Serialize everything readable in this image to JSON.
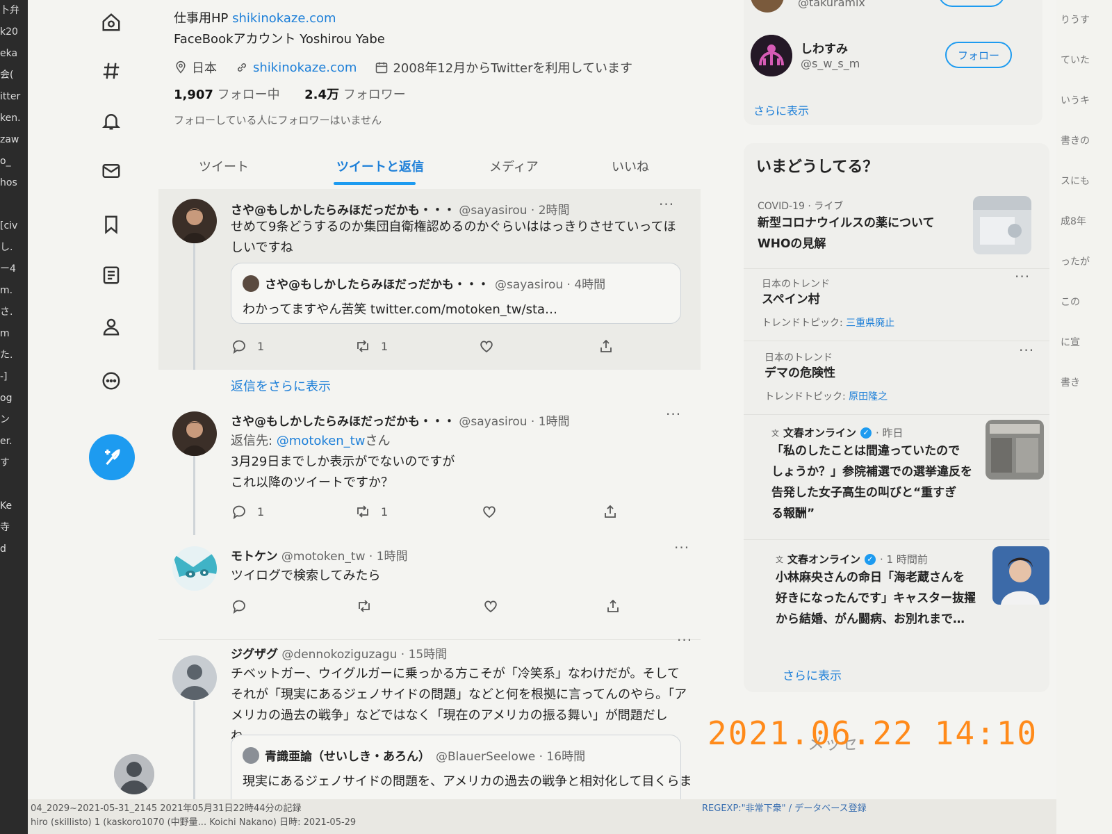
{
  "left_strip": [
    "卜弁",
    "k20",
    "eka",
    "会(",
    "itter",
    "ken.",
    "zaw",
    "o_",
    "hos",
    "",
    "[civ",
    "し.",
    "ー4",
    "m.",
    "さ.",
    "m",
    "た.",
    "-]",
    "og",
    "ン",
    "er.",
    "す",
    "",
    "Ke",
    "寺",
    "d"
  ],
  "profile": {
    "bio_line1_prefix": "仕事用HP ",
    "bio_line1_link": "shikinokaze.com",
    "bio_line2": "FaceBookアカウント Yoshirou Yabe",
    "location": "日本",
    "website": "shikinokaze.com",
    "joined": "2008年12月からTwitterを利用しています",
    "following_count": "1,907",
    "following_label": "フォロー中",
    "followers_count": "2.4万",
    "followers_label": "フォロワー",
    "no_mutual": "フォローしている人にフォロワーはいません"
  },
  "tabs": [
    {
      "label": "ツイート"
    },
    {
      "label": "ツイートと返信"
    },
    {
      "label": "メディア"
    },
    {
      "label": "いいね"
    }
  ],
  "tweets": [
    {
      "name": "さや@もしかしたらみほだっだかも・・・",
      "handle": "@sayasirou · 2時間",
      "text": "せめて9条どうするのか集団自衛権認めるのかぐらいははっきりさせていってほしいですね",
      "quote": {
        "name": "さや@もしかしたらみほだっだかも・・・",
        "handle": "@sayasirou · 4時間",
        "text": "わかってますやん苦笑 twitter.com/motoken_tw/sta…"
      },
      "replies": "1",
      "retweets": "1"
    },
    {
      "show_more": "返信をさらに表示"
    },
    {
      "name": "さや@もしかしたらみほだっだかも・・・",
      "handle": "@sayasirou · 1時間",
      "reply_prefix": "返信先: ",
      "reply_user": "@motoken_tw",
      "reply_suffix": "さん",
      "text1": "3月29日までしか表示がでないのですが",
      "text2": "これ以降のツイートですか？",
      "replies": "1",
      "retweets": "1"
    },
    {
      "name": "モトケン",
      "handle": "@motoken_tw · 1時間",
      "text": "ツイログで検索してみたら"
    },
    {
      "name": "ジグザグ",
      "handle": "@dennokoziguzagu · 15時間",
      "text": "チベットガー、ウイグルガーに乗っかる方こそが「冷笑系」なわけだが。そしてそれが「現実にあるジェノサイドの問題」などと何を根拠に言ってんのやら。「アメリカの過去の戦争」などではなく「現在のアメリカの振る舞い」が問題だしね。",
      "quote": {
        "name": "青識亜論（せいしき・あろん）",
        "handle": "@BlauerSeelowe · 16時間",
        "text": "現実にあるジェノサイドの問題を、アメリカの過去の戦争と相対化して目くらま"
      }
    }
  ],
  "sidebar": {
    "top_handle": "@takuramix",
    "suggest_name": "しわすみ",
    "suggest_handle": "@s_w_s_m",
    "follow_label": "フォロー",
    "show_more": "さらに表示",
    "trends_title": "いまどうしてる？",
    "trends": [
      {
        "category": "COVID-19 · ライブ",
        "title1": "新型コロナウイルスの薬について",
        "title2": "WHOの見解"
      },
      {
        "category": "日本のトレンド",
        "title": "スペイン村",
        "topic_label": "トレンドトピック: ",
        "topic": "三重県廃止"
      },
      {
        "category": "日本のトレンド",
        "title": "デマの危険性",
        "topic_label": "トレンドトピック: ",
        "topic": "原田隆之"
      }
    ],
    "news": [
      {
        "source": "文春オンライン",
        "time": "· 昨日",
        "lines": [
          "「私のしたことは間違っていたので",
          "しょうか？」参院補選での選挙違反を",
          "告発した女子高生の叫びと“重すぎ",
          "る報酬”"
        ]
      },
      {
        "source": "文春オンライン",
        "time": "· 1 時間前",
        "lines": [
          "小林麻央さんの命日「海老蔵さんを",
          "好きになったんです」キャスター抜擢",
          "から結婚、がん闘病、お別れまで…"
        ]
      }
    ],
    "show_more2": "さらに表示"
  },
  "overlay": {
    "timestamp": "2021.06.22  14:10",
    "message_ghost": "メッセ"
  },
  "bottom": {
    "line1": "04_2029~2021-05-31_2145 2021年05月31日22時44分の記録",
    "line2": "hiro (skillisto) 1 (kaskoro1070 (中野量...   Koichi Nakano) 日時: 2021-05-29",
    "line3": "REGEXP:\"非常下衆\" / データベース登録"
  },
  "right_strip": [
    "りうす",
    "ていた",
    "いうキ",
    "書きの",
    "スにも",
    "成8年",
    "ったが",
    "この",
    "に宣",
    "書き",
    "",
    "",
    "",
    "",
    "",
    "",
    "",
    ""
  ],
  "colors": {
    "accent": "#1d9bf0",
    "link": "#1d7fd8",
    "timestamp": "#ff8a1a"
  }
}
